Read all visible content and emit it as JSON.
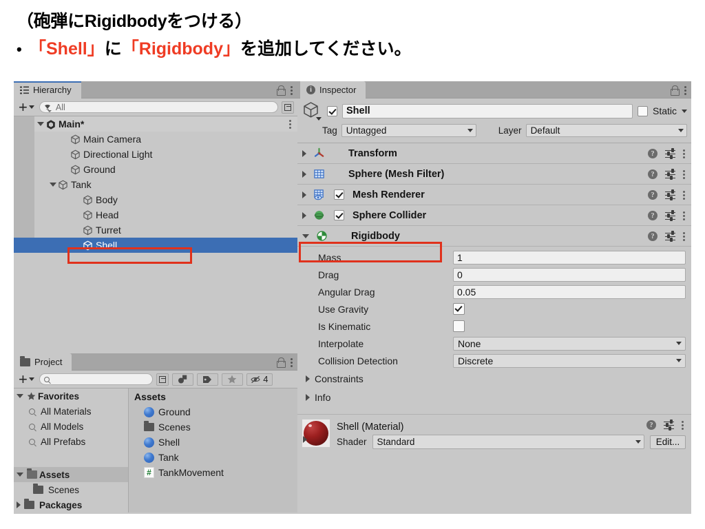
{
  "slide": {
    "line1": "（砲弾にRigidbodyをつける）",
    "bullet": "•",
    "line2_part1": "「Shell」",
    "line2_part2": " に ",
    "line2_part3": "「Rigidbody」",
    "line2_part4": "を追加してください。",
    "accent_color": "#ef3c24"
  },
  "hierarchy": {
    "tab_label": "Hierarchy",
    "search_placeholder": "All",
    "rows": [
      {
        "label": "Main*",
        "depth": 0,
        "expanded": true,
        "type": "scene",
        "selected": false
      },
      {
        "label": "Main Camera",
        "depth": 2,
        "expanded": null,
        "type": "object",
        "selected": false
      },
      {
        "label": "Directional Light",
        "depth": 2,
        "expanded": null,
        "type": "object",
        "selected": false
      },
      {
        "label": "Ground",
        "depth": 2,
        "expanded": null,
        "type": "object",
        "selected": false
      },
      {
        "label": "Tank",
        "depth": 1,
        "expanded": true,
        "type": "object",
        "selected": false
      },
      {
        "label": "Body",
        "depth": 3,
        "expanded": null,
        "type": "object",
        "selected": false
      },
      {
        "label": "Head",
        "depth": 3,
        "expanded": null,
        "type": "object",
        "selected": false
      },
      {
        "label": "Turret",
        "depth": 3,
        "expanded": null,
        "type": "object",
        "selected": false
      },
      {
        "label": "Shell",
        "depth": 3,
        "expanded": null,
        "type": "object",
        "selected": true
      }
    ]
  },
  "inspector": {
    "tab_label": "Inspector",
    "object_name": "Shell",
    "object_enabled": true,
    "static_label": "Static",
    "static_checked": false,
    "tag_label": "Tag",
    "tag_value": "Untagged",
    "layer_label": "Layer",
    "layer_value": "Default",
    "components": [
      {
        "name": "Transform",
        "expanded": false,
        "has_toggle": false,
        "enabled": null,
        "icon": "transform-icon",
        "highlighted": false
      },
      {
        "name": "Sphere (Mesh Filter)",
        "expanded": false,
        "has_toggle": false,
        "enabled": null,
        "icon": "mesh-filter-icon",
        "highlighted": false
      },
      {
        "name": "Mesh Renderer",
        "expanded": false,
        "has_toggle": true,
        "enabled": true,
        "icon": "mesh-renderer-icon",
        "highlighted": false
      },
      {
        "name": "Sphere Collider",
        "expanded": false,
        "has_toggle": true,
        "enabled": true,
        "icon": "sphere-collider-icon",
        "highlighted": false
      },
      {
        "name": "Rigidbody",
        "expanded": true,
        "has_toggle": false,
        "enabled": null,
        "icon": "rigidbody-icon",
        "highlighted": true
      }
    ],
    "rigidbody_props": [
      {
        "label": "Mass",
        "value": "1",
        "kind": "text"
      },
      {
        "label": "Drag",
        "value": "0",
        "kind": "text"
      },
      {
        "label": "Angular Drag",
        "value": "0.05",
        "kind": "text"
      },
      {
        "label": "Use Gravity",
        "value": true,
        "kind": "checkbox"
      },
      {
        "label": "Is Kinematic",
        "value": false,
        "kind": "checkbox"
      },
      {
        "label": "Interpolate",
        "value": "None",
        "kind": "dropdown"
      },
      {
        "label": "Collision Detection",
        "value": "Discrete",
        "kind": "dropdown"
      }
    ],
    "rigidbody_foldouts": [
      "Constraints",
      "Info"
    ],
    "material": {
      "title": "Shell (Material)",
      "shader_label": "Shader",
      "shader_value": "Standard",
      "edit_label": "Edit..."
    }
  },
  "project": {
    "tab_label": "Project",
    "search_placeholder": "",
    "hidden_count": "4",
    "favorites_label": "Favorites",
    "favorites": [
      "All Materials",
      "All Models",
      "All Prefabs"
    ],
    "assets_label": "Assets",
    "assets_children": [
      "Scenes"
    ],
    "packages_label": "Packages",
    "content_header": "Assets",
    "content_items": [
      {
        "label": "Ground",
        "type": "material"
      },
      {
        "label": "Scenes",
        "type": "folder"
      },
      {
        "label": "Shell",
        "type": "material"
      },
      {
        "label": "Tank",
        "type": "material"
      },
      {
        "label": "TankMovement",
        "type": "script"
      }
    ]
  }
}
